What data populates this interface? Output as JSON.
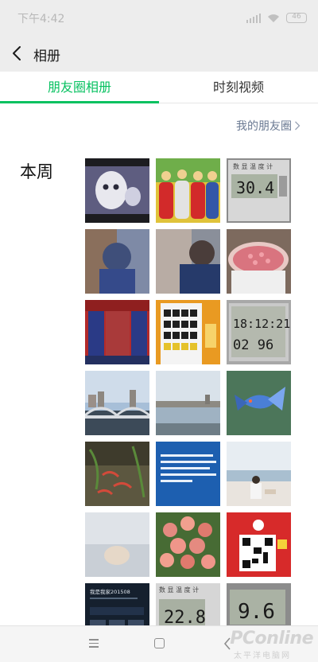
{
  "status_bar": {
    "time": "下午4:42",
    "battery": "46"
  },
  "nav": {
    "title": "相册"
  },
  "tabs": [
    {
      "label": "朋友圈相册",
      "active": true
    },
    {
      "label": "时刻视频",
      "active": false
    }
  ],
  "moments_link": "我的朋友圈",
  "section": {
    "label": "本周"
  },
  "photos": [
    {
      "name": "photo-ghost-cartoon",
      "thermo_text": ""
    },
    {
      "name": "photo-plush-toys",
      "thermo_text": ""
    },
    {
      "name": "photo-thermometer-1",
      "thermo_text": "30.4"
    },
    {
      "name": "photo-blurred-child-1",
      "thermo_text": ""
    },
    {
      "name": "photo-blurred-child-2",
      "thermo_text": ""
    },
    {
      "name": "photo-pink-food-bowl",
      "thermo_text": ""
    },
    {
      "name": "photo-red-door",
      "thermo_text": ""
    },
    {
      "name": "photo-vending-machine",
      "thermo_text": ""
    },
    {
      "name": "photo-digital-clock",
      "thermo_text": "18:12:21 02 96"
    },
    {
      "name": "photo-bridge-city",
      "thermo_text": ""
    },
    {
      "name": "photo-river-city",
      "thermo_text": ""
    },
    {
      "name": "photo-betta-fish",
      "thermo_text": ""
    },
    {
      "name": "photo-shrimp-tank",
      "thermo_text": ""
    },
    {
      "name": "photo-blue-notice",
      "thermo_text": ""
    },
    {
      "name": "photo-beach",
      "thermo_text": ""
    },
    {
      "name": "photo-blurred-fog",
      "thermo_text": ""
    },
    {
      "name": "photo-pink-roses",
      "thermo_text": ""
    },
    {
      "name": "photo-qr-code-card",
      "thermo_text": ""
    },
    {
      "name": "photo-phone-screen",
      "thermo_text": "我是我家201508"
    },
    {
      "name": "photo-thermometer-2",
      "thermo_text": "22.8"
    },
    {
      "name": "photo-thermometer-3",
      "thermo_text": "9.6"
    }
  ],
  "thermo_caption": "数 显 温 度 计",
  "watermark": {
    "text": "PConline",
    "sub": "太平洋电脑网"
  },
  "colors": {
    "accent": "#07c160",
    "link": "#6b7a93",
    "bar_bg": "#ededed"
  },
  "icons": [
    "back-icon",
    "chevron-right-icon",
    "signal-icon",
    "wifi-icon",
    "battery-icon",
    "menu-key-icon",
    "home-key-icon",
    "back-key-icon"
  ]
}
